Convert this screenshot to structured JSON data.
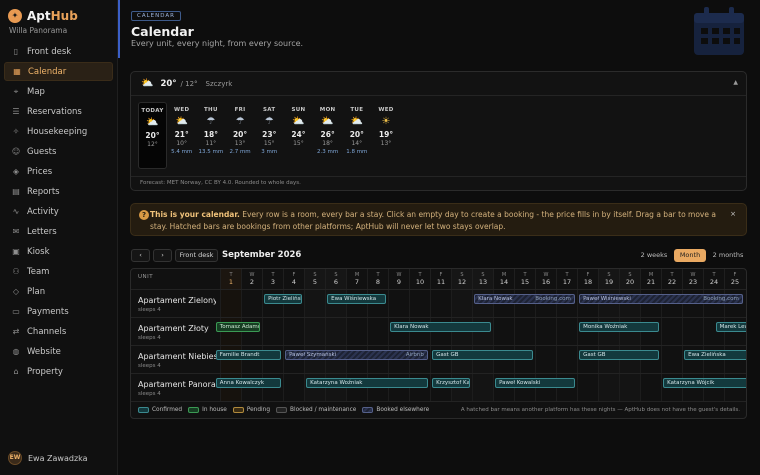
{
  "app": {
    "brand_mark": "✦",
    "brand_a": "Apt",
    "brand_b": "Hub",
    "property": "Willa Panorama"
  },
  "sidebar": {
    "items": [
      {
        "label": "Front desk",
        "icon": "door-icon",
        "glyph": "▯"
      },
      {
        "label": "Calendar",
        "icon": "calendar-icon",
        "glyph": "▦",
        "active": true
      },
      {
        "label": "Map",
        "icon": "map-icon",
        "glyph": "⌖"
      },
      {
        "label": "Reservations",
        "icon": "list-icon",
        "glyph": "☰"
      },
      {
        "label": "Housekeeping",
        "icon": "broom-icon",
        "glyph": "✧"
      },
      {
        "label": "Guests",
        "icon": "people-icon",
        "glyph": "☺"
      },
      {
        "label": "Prices",
        "icon": "tag-icon",
        "glyph": "◈"
      },
      {
        "label": "Reports",
        "icon": "chart-icon",
        "glyph": "▤"
      },
      {
        "label": "Activity",
        "icon": "pulse-icon",
        "glyph": "∿"
      },
      {
        "label": "Letters",
        "icon": "mail-icon",
        "glyph": "✉"
      },
      {
        "label": "Kiosk",
        "icon": "kiosk-icon",
        "glyph": "▣"
      },
      {
        "label": "Team",
        "icon": "team-icon",
        "glyph": "⚇"
      },
      {
        "label": "Plan",
        "icon": "plan-icon",
        "glyph": "◇"
      },
      {
        "label": "Payments",
        "icon": "card-icon",
        "glyph": "▭"
      },
      {
        "label": "Channels",
        "icon": "channels-icon",
        "glyph": "⇄"
      },
      {
        "label": "Website",
        "icon": "globe-icon",
        "glyph": "◍"
      },
      {
        "label": "Property",
        "icon": "home-icon",
        "glyph": "⌂"
      }
    ]
  },
  "user": {
    "initials": "EW",
    "name": "Ewa Zawadzka"
  },
  "header": {
    "badge": "CALENDAR",
    "title": "Calendar",
    "subtitle": "Every unit, every night, from every source."
  },
  "weather": {
    "now": "20°",
    "low": "/ 12°",
    "location": "Szczyrk",
    "collapse": "▲",
    "days": [
      {
        "name": "TODAY",
        "kind": "partly",
        "hi": "20°",
        "lo": "12°",
        "precip": ""
      },
      {
        "name": "WED",
        "kind": "partly",
        "hi": "21°",
        "lo": "10°",
        "precip": "5.4 mm"
      },
      {
        "name": "THU",
        "kind": "rain",
        "hi": "18°",
        "lo": "11°",
        "precip": "13.5 mm"
      },
      {
        "name": "FRI",
        "kind": "rain",
        "hi": "20°",
        "lo": "13°",
        "precip": "2.7 mm"
      },
      {
        "name": "SAT",
        "kind": "rain",
        "hi": "23°",
        "lo": "15°",
        "precip": "3 mm"
      },
      {
        "name": "SUN",
        "kind": "partly",
        "hi": "24°",
        "lo": "15°",
        "precip": ""
      },
      {
        "name": "MON",
        "kind": "partly",
        "hi": "26°",
        "lo": "18°",
        "precip": "2.3 mm"
      },
      {
        "name": "TUE",
        "kind": "partly",
        "hi": "20°",
        "lo": "14°",
        "precip": "1.8 mm"
      },
      {
        "name": "WED",
        "kind": "sun",
        "hi": "19°",
        "lo": "13°",
        "precip": ""
      }
    ],
    "footer": "Forecast: MET Norway, CC BY 4.0. Rounded to whole days."
  },
  "banner": {
    "icon": "?",
    "bold": "This is your calendar.",
    "text": " Every row is a room, every bar a stay. Click an empty day to create a booking - the price fills in by itself. Drag a bar to move a stay. Hatched bars are bookings from other platforms; AptHub will never let two stays overlap.",
    "close": "×"
  },
  "toolbar": {
    "prev": "‹",
    "next": "›",
    "front_desk": "Front desk",
    "month": "September 2026",
    "ranges": [
      "2 weeks",
      "Month",
      "2 months"
    ],
    "selected_range": "Month"
  },
  "calendar": {
    "unit_header": "UNIT",
    "days": [
      {
        "dow": "T",
        "num": "1",
        "today": true
      },
      {
        "dow": "W",
        "num": "2"
      },
      {
        "dow": "T",
        "num": "3"
      },
      {
        "dow": "F",
        "num": "4"
      },
      {
        "dow": "S",
        "num": "5",
        "weekend": true
      },
      {
        "dow": "S",
        "num": "6",
        "weekend": true
      },
      {
        "dow": "M",
        "num": "7"
      },
      {
        "dow": "T",
        "num": "8"
      },
      {
        "dow": "W",
        "num": "9"
      },
      {
        "dow": "T",
        "num": "10"
      },
      {
        "dow": "F",
        "num": "11"
      },
      {
        "dow": "S",
        "num": "12",
        "weekend": true
      },
      {
        "dow": "S",
        "num": "13",
        "weekend": true
      },
      {
        "dow": "M",
        "num": "14"
      },
      {
        "dow": "T",
        "num": "15"
      },
      {
        "dow": "W",
        "num": "16"
      },
      {
        "dow": "T",
        "num": "17"
      },
      {
        "dow": "F",
        "num": "18"
      },
      {
        "dow": "S",
        "num": "19",
        "weekend": true
      },
      {
        "dow": "S",
        "num": "20",
        "weekend": true
      },
      {
        "dow": "M",
        "num": "21"
      },
      {
        "dow": "T",
        "num": "22"
      },
      {
        "dow": "W",
        "num": "23"
      },
      {
        "dow": "T",
        "num": "24"
      },
      {
        "dow": "F",
        "num": "25"
      }
    ],
    "units": [
      {
        "name": "Apartament Zielony",
        "sleeps": "sleeps 4",
        "bookings": [
          {
            "guest": "Piotr Zieliński",
            "start": 2.1,
            "end": 3.9,
            "status": "confirmed"
          },
          {
            "guest": "Ewa Wiśniewska",
            "start": 5.1,
            "end": 7.9,
            "status": "confirmed"
          },
          {
            "guest": "Klara Nowak",
            "start": 12.1,
            "end": 16.9,
            "status": "elsewhere",
            "source": "Booking.com"
          },
          {
            "guest": "Paweł Wiśniewski",
            "start": 17.1,
            "end": 24.9,
            "status": "elsewhere",
            "source": "Booking.com"
          }
        ]
      },
      {
        "name": "Apartament Złoty",
        "sleeps": "sleeps 4",
        "bookings": [
          {
            "guest": "Tomasz Adamczyk",
            "start": -0.2,
            "end": 1.9,
            "status": "inhouse"
          },
          {
            "guest": "Klara Nowak",
            "start": 8.1,
            "end": 12.9,
            "status": "confirmed"
          },
          {
            "guest": "Monika Woźniak",
            "start": 17.1,
            "end": 20.9,
            "status": "confirmed"
          },
          {
            "guest": "Marek Lewandowski",
            "start": 23.6,
            "end": 25.6,
            "status": "confirmed"
          }
        ]
      },
      {
        "name": "Apartament Niebieski",
        "sleeps": "sleeps 4",
        "bookings": [
          {
            "guest": "Familie Brandt",
            "start": -0.2,
            "end": 2.9,
            "status": "confirmed"
          },
          {
            "guest": "Paweł Szymański",
            "start": 3.1,
            "end": 9.9,
            "status": "elsewhere",
            "source": "Airbnb"
          },
          {
            "guest": "Gast GB",
            "start": 10.1,
            "end": 14.9,
            "status": "confirmed"
          },
          {
            "guest": "Gast GB",
            "start": 17.1,
            "end": 20.9,
            "status": "confirmed"
          },
          {
            "guest": "Ewa Zielińska",
            "start": 22.1,
            "end": 25.6,
            "status": "confirmed"
          }
        ]
      },
      {
        "name": "Apartament Panoramiczny",
        "sleeps": "sleeps 4",
        "bookings": [
          {
            "guest": "Anna Kowalczyk",
            "start": -0.2,
            "end": 2.9,
            "status": "confirmed"
          },
          {
            "guest": "Katarzyna Woźniak",
            "start": 4.1,
            "end": 9.9,
            "status": "confirmed"
          },
          {
            "guest": "Krzysztof Kamiński",
            "start": 10.1,
            "end": 11.9,
            "status": "confirmed"
          },
          {
            "guest": "Paweł Kowalski",
            "start": 13.1,
            "end": 16.9,
            "status": "confirmed"
          },
          {
            "guest": "Katarzyna Wójcik",
            "start": 21.1,
            "end": 25.6,
            "status": "confirmed"
          }
        ]
      }
    ],
    "legend": [
      {
        "label": "Confirmed",
        "status": "confirmed"
      },
      {
        "label": "In house",
        "status": "inhouse"
      },
      {
        "label": "Pending",
        "status": "pending"
      },
      {
        "label": "Blocked / maintenance",
        "status": "blocked"
      },
      {
        "label": "Booked elsewhere",
        "status": "elsewhere"
      }
    ],
    "note": "A hatched bar means another platform has these nights — AptHub does not have the guest's details."
  }
}
